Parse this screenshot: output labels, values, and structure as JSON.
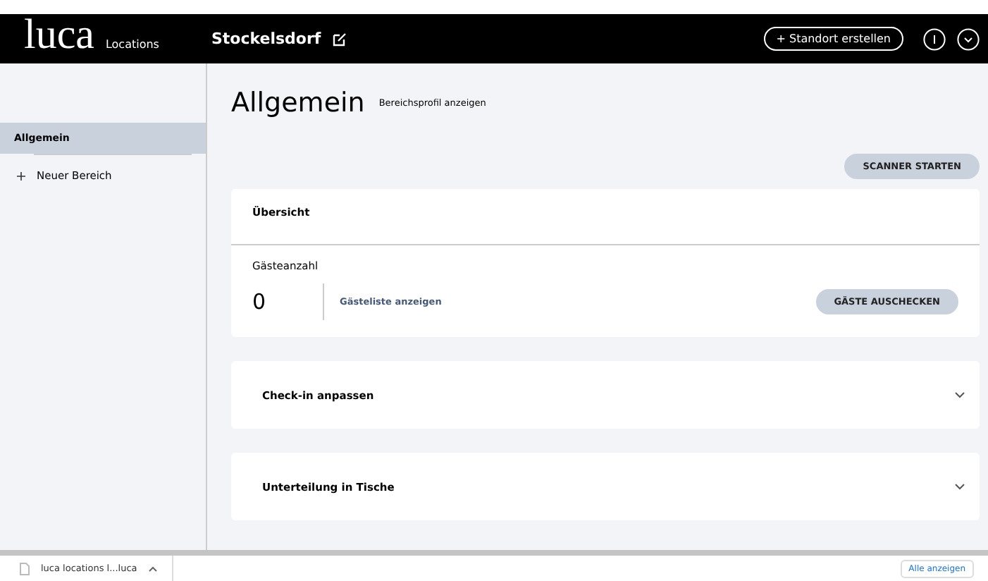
{
  "header": {
    "logo": "luca",
    "logo_sub": "Locations",
    "location": "Stockelsdorf",
    "create_button": "+ Standort erstellen"
  },
  "sidebar": {
    "items": [
      {
        "kind": "area",
        "label": "Allgemein",
        "selected": true
      },
      {
        "kind": "add",
        "label": "Neuer Bereich",
        "selected": false
      }
    ]
  },
  "page": {
    "title": "Allgemein",
    "profile_link": "Bereichsprofil anzeigen",
    "scanner_button": "SCANNER STARTEN"
  },
  "overview": {
    "title": "Übersicht",
    "guest_label": "Gästeanzahl",
    "guest_count": "0",
    "guest_list_link": "Gästeliste anzeigen",
    "checkout_button": "GÄSTE AUSCHECKEN"
  },
  "sections": [
    {
      "title": "Check-in anpassen",
      "expanded": false
    },
    {
      "title": "Unterteilung in Tische",
      "expanded": false
    }
  ],
  "downloads": {
    "file": "luca locations l...luca",
    "show_all": "Alle anzeigen"
  }
}
